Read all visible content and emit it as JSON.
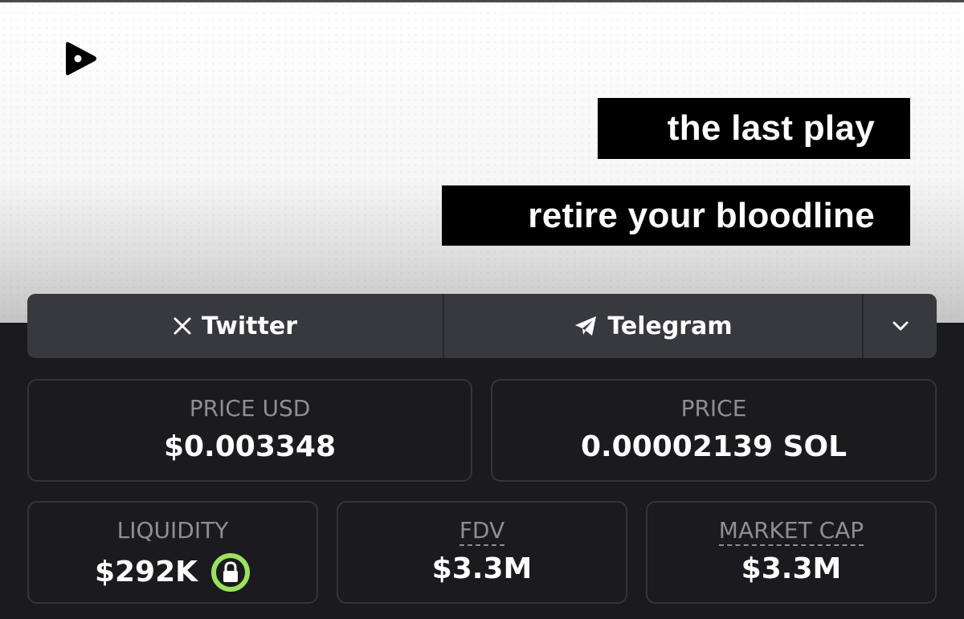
{
  "banner": {
    "logo_icon": "play-triangle-icon",
    "tagline_1": "the last play",
    "tagline_2": "retire your bloodline"
  },
  "socials": {
    "twitter_label": "Twitter",
    "twitter_icon": "x-logo-icon",
    "telegram_label": "Telegram",
    "telegram_icon": "paper-plane-icon",
    "more_icon": "chevron-down-icon"
  },
  "stats": {
    "price_usd": {
      "label": "PRICE USD",
      "value": "$0.003348"
    },
    "price": {
      "label": "PRICE",
      "value": "0.00002139 SOL"
    },
    "liquidity": {
      "label": "LIQUIDITY",
      "value": "$292K",
      "icon": "lock-icon",
      "icon_color": "#9be15d"
    },
    "fdv": {
      "label": "FDV",
      "value": "$3.3M"
    },
    "market_cap": {
      "label": "MARKET CAP",
      "value": "$3.3M"
    }
  }
}
